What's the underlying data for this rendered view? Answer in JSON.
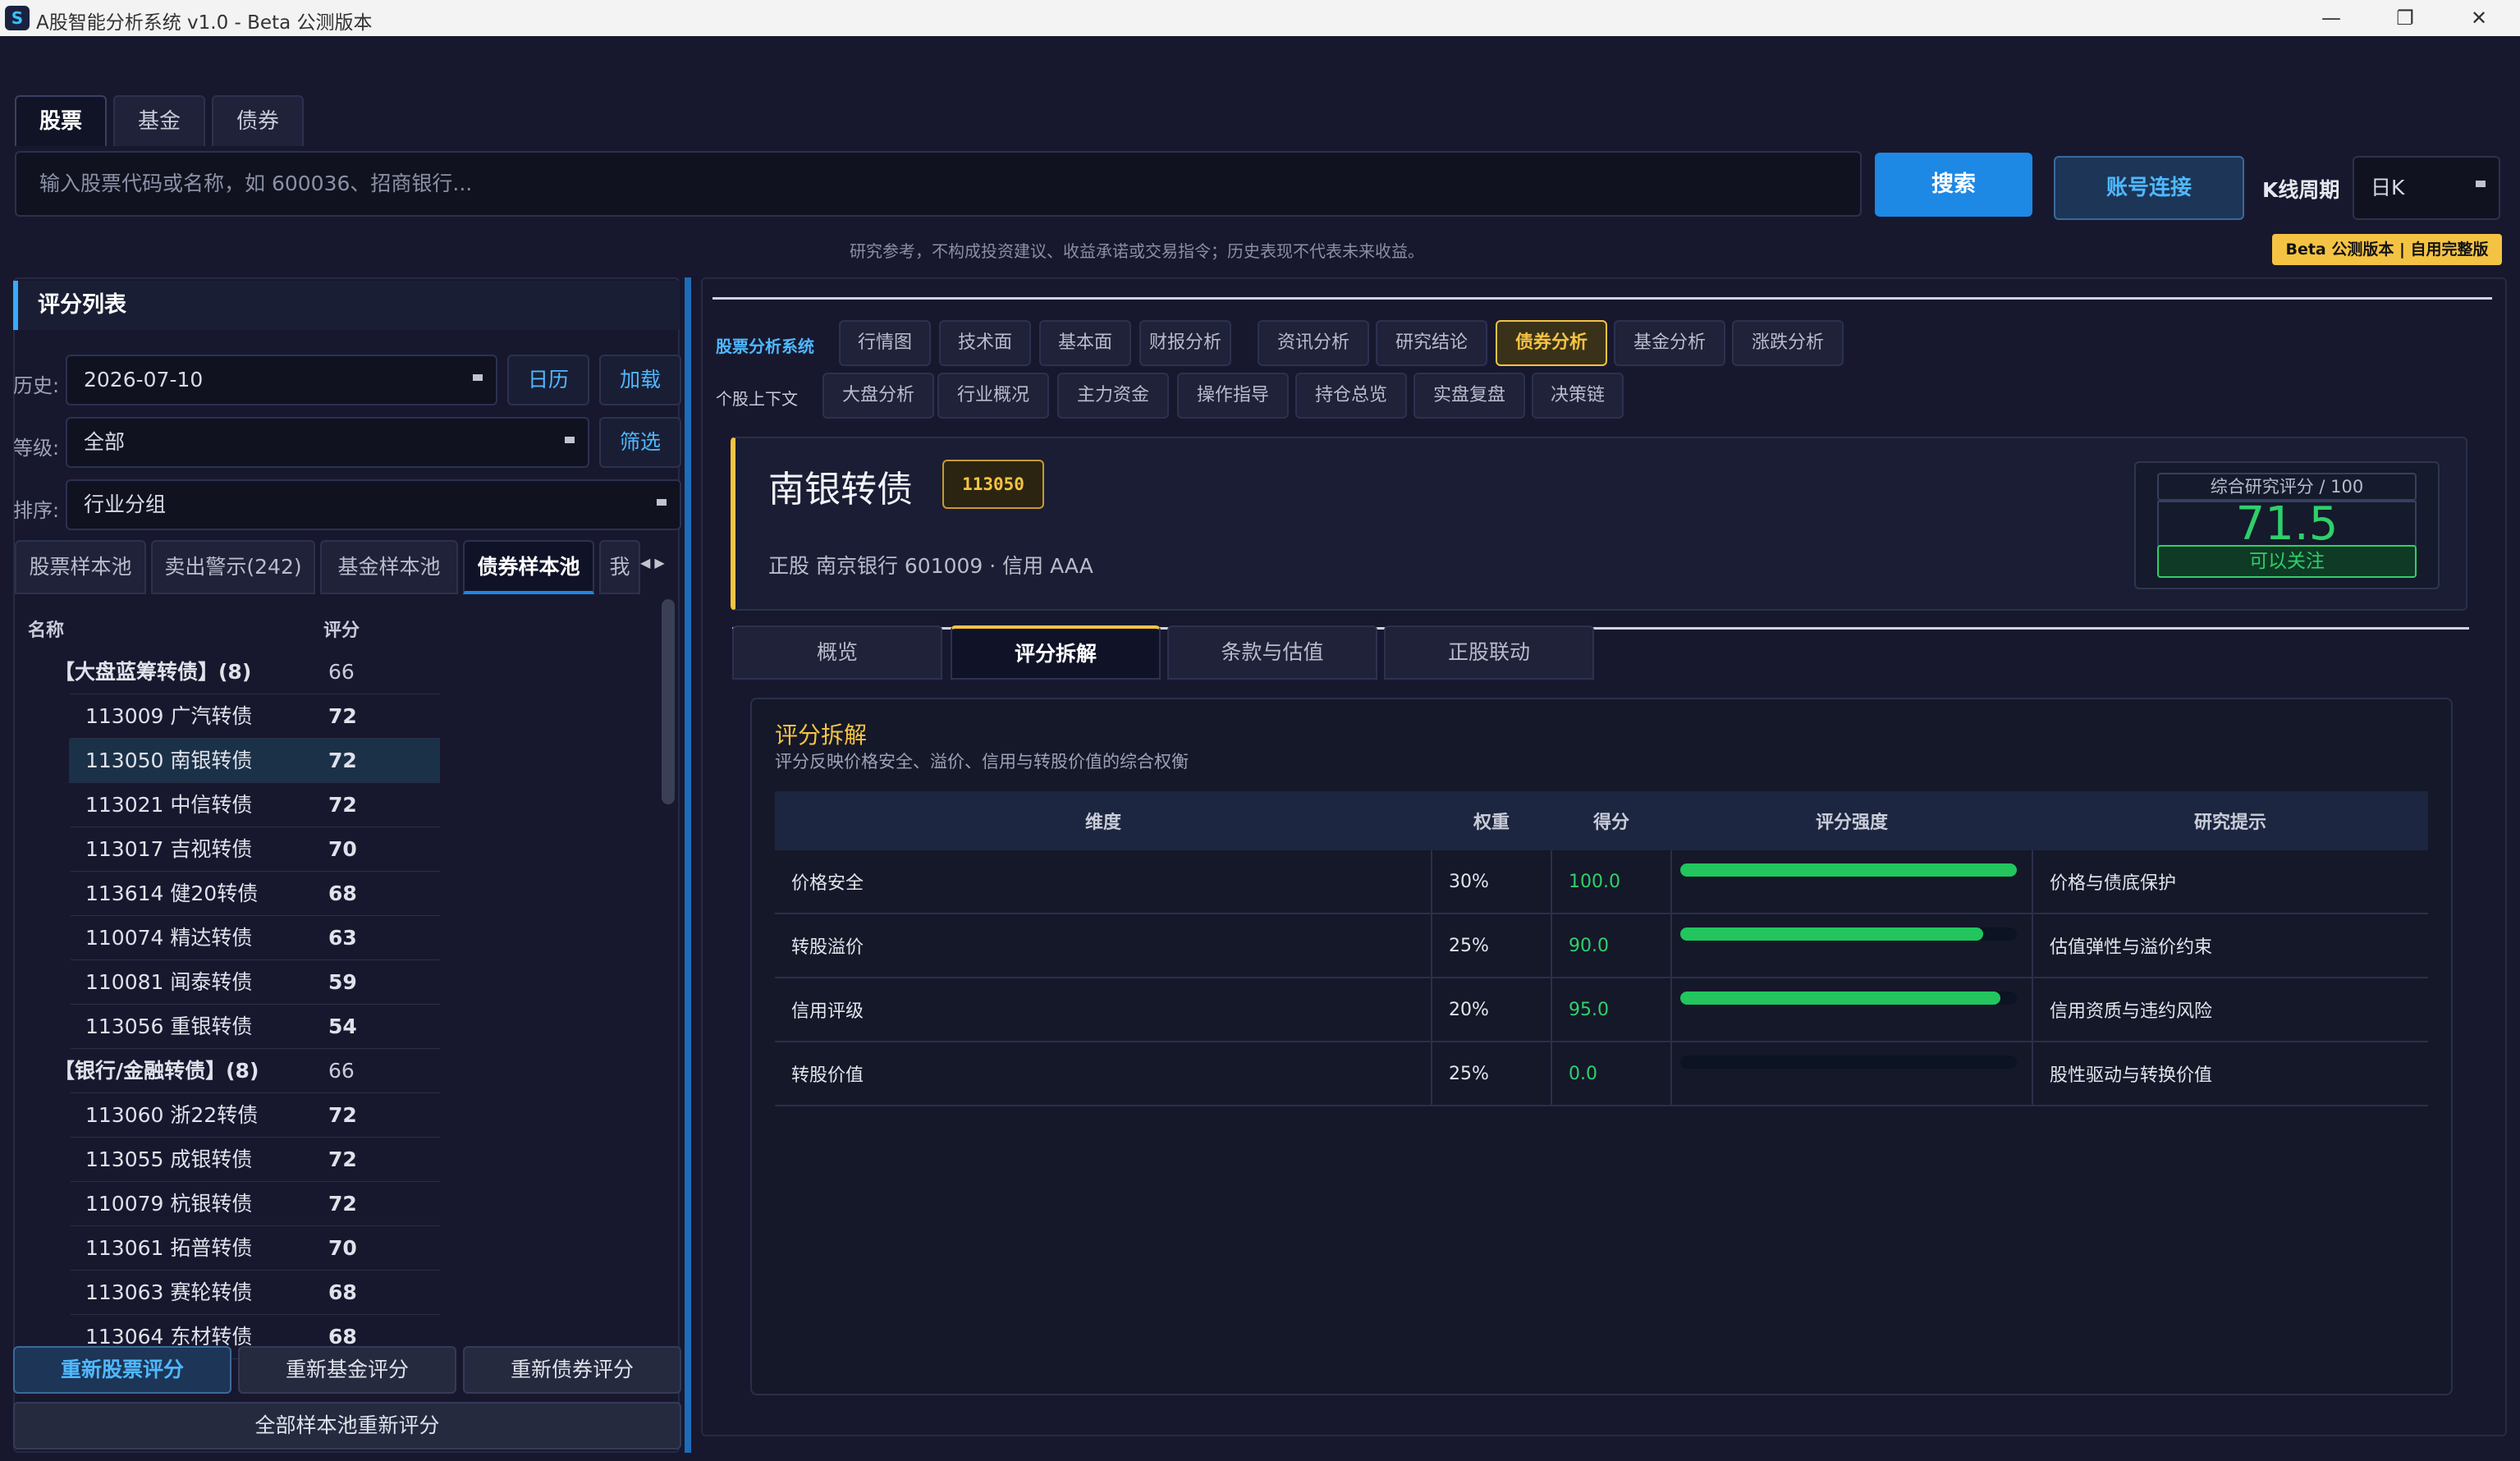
{
  "window": {
    "title": "A股智能分析系统 v1.0 - Beta 公测版本",
    "controls": [
      "—",
      "❐",
      "✕"
    ]
  },
  "market_tabs": [
    "股票",
    "基金",
    "债券"
  ],
  "search": {
    "placeholder": "输入股票代码或名称，如 600036、招商银行...",
    "search_label": "搜索",
    "account_label": "账号连接",
    "kline_label": "K线周期",
    "kline_value": "日K"
  },
  "disclaimer": "研究参考，不构成投资建议、收益承诺或交易指令；历史表现不代表未来收益。",
  "beta_badge": "Beta 公测版本 | 自用完整版",
  "left": {
    "title": "评分列表",
    "history_label": "历史:",
    "history_value": "2026-07-10",
    "calendar_btn": "日历",
    "load_btn": "加载",
    "grade_label": "等级:",
    "grade_value": "全部",
    "filter_btn": "筛选",
    "sort_label": "排序:",
    "sort_value": "行业分组",
    "tabs": [
      "股票样本池",
      "卖出警示(242)",
      "基金样本池",
      "债券样本池",
      "我"
    ],
    "col_name": "名称",
    "col_score": "评分",
    "rows": [
      {
        "name": "【大盘蓝筹转债】(8)",
        "score": "66",
        "group": true
      },
      {
        "name": "113009 广汽转债",
        "score": "72"
      },
      {
        "name": "113050 南银转债",
        "score": "72",
        "selected": true
      },
      {
        "name": "113021 中信转债",
        "score": "72"
      },
      {
        "name": "113017 吉视转债",
        "score": "70"
      },
      {
        "name": "113614 健20转债",
        "score": "68"
      },
      {
        "name": "110074 精达转债",
        "score": "63"
      },
      {
        "name": "110081 闻泰转债",
        "score": "59"
      },
      {
        "name": "113056 重银转债",
        "score": "54"
      },
      {
        "name": "【银行/金融转债】(8)",
        "score": "66",
        "group": true
      },
      {
        "name": "113060 浙22转债",
        "score": "72"
      },
      {
        "name": "113055 成银转债",
        "score": "72"
      },
      {
        "name": "110079 杭银转债",
        "score": "72"
      },
      {
        "name": "113061 拓普转债",
        "score": "70"
      },
      {
        "name": "113063 赛轮转债",
        "score": "68"
      },
      {
        "name": "113064 东材转债",
        "score": "68"
      }
    ],
    "rescore_stock": "重新股票评分",
    "rescore_fund": "重新基金评分",
    "rescore_bond": "重新债券评分",
    "rescore_all": "全部样本池重新评分"
  },
  "right": {
    "nav_label": "股票分析系统",
    "nav_tabs": [
      "行情图",
      "技术面",
      "基本面",
      "财报分析",
      "资讯分析",
      "研究结论",
      "债券分析",
      "基金分析",
      "涨跌分析"
    ],
    "nav_active": "债券分析",
    "sub_label": "个股上下文",
    "sub_tabs": [
      "大盘分析",
      "行业概况",
      "主力资金",
      "操作指导",
      "持仓总览",
      "实盘复盘",
      "决策链"
    ],
    "bond": {
      "name": "南银转债",
      "code": "113050",
      "meta": "正股 南京银行 601009 · 信用 AAA",
      "score_title": "综合研究评分 / 100",
      "score": "71.5",
      "verdict": "可以关注"
    },
    "detail_tabs": [
      "概览",
      "评分拆解",
      "条款与估值",
      "正股联动"
    ],
    "detail_active": "评分拆解",
    "breakdown": {
      "title": "评分拆解",
      "subtitle": "评分反映价格安全、溢价、信用与转股价值的综合权衡",
      "headers": [
        "维度",
        "权重",
        "得分",
        "评分强度",
        "研究提示"
      ],
      "rows": [
        {
          "dim": "价格安全",
          "weight": "30%",
          "score": "100.0",
          "strength": 1.0,
          "hint": "价格与债底保护"
        },
        {
          "dim": "转股溢价",
          "weight": "25%",
          "score": "90.0",
          "strength": 0.9,
          "hint": "估值弹性与溢价约束"
        },
        {
          "dim": "信用评级",
          "weight": "20%",
          "score": "95.0",
          "strength": 0.95,
          "hint": "信用资质与违约风险"
        },
        {
          "dim": "转股价值",
          "weight": "25%",
          "score": "0.0",
          "strength": 0.0,
          "hint": "股性驱动与转换价值"
        }
      ]
    }
  },
  "colors": {
    "accent_blue": "#1e88e5",
    "accent_gold": "#f5c343",
    "score_green": "#2ed06a",
    "background": "#17182e"
  }
}
